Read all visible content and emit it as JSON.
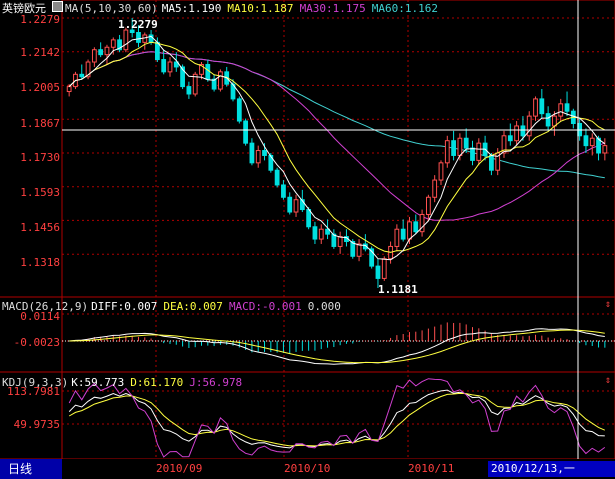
{
  "main_panel": {
    "title": "英镑欧元",
    "ma_label": "MA(5,10,30,60)",
    "ma5": "MA5:1.190",
    "ma10": "MA10:1.187",
    "ma30": "MA30:1.175",
    "ma60": "MA60:1.162",
    "high_marker": "1.2279",
    "low_marker": "1.1181",
    "y_ticks": [
      "1.2279",
      "1.2142",
      "1.2005",
      "1.1867",
      "1.1730",
      "1.1593",
      "1.1456",
      "1.1318"
    ]
  },
  "macd_panel": {
    "label": "MACD(26,12,9)",
    "diff": "DIFF:0.007",
    "dea": "DEA:0.007",
    "macd": "MACD:-0.001",
    "extra": "0.000",
    "y_ticks": [
      "0.0114",
      "-0.0023"
    ]
  },
  "kdj_panel": {
    "label": "KDJ(9,3,3)",
    "k": "K:59.773",
    "d": "D:61.170",
    "j": "J:56.978",
    "y_ticks": [
      "113.7981",
      "49.9735"
    ]
  },
  "footer": {
    "period_tab": "日线",
    "x_labels": [
      "2010/09",
      "2010/10",
      "2010/11"
    ],
    "cursor_date": "2010/12/13,一"
  },
  "colors": {
    "up": "#ff5050",
    "down": "#00e0e0",
    "ma5": "#ffffff",
    "ma10": "#ffff40",
    "ma30": "#d040d0",
    "ma60": "#40d0d0",
    "grid": "#b00000"
  },
  "chart_data": {
    "type": "candlestick",
    "price_range": [
      1.1181,
      1.2279
    ],
    "candles": [
      [
        1.198,
        1.201,
        1.196,
        1.2
      ],
      [
        1.2,
        1.206,
        1.199,
        1.205
      ],
      [
        1.205,
        1.209,
        1.203,
        1.204
      ],
      [
        1.204,
        1.211,
        1.203,
        1.21
      ],
      [
        1.21,
        1.216,
        1.208,
        1.215
      ],
      [
        1.215,
        1.218,
        1.212,
        1.213
      ],
      [
        1.213,
        1.217,
        1.209,
        1.216
      ],
      [
        1.216,
        1.22,
        1.213,
        1.219
      ],
      [
        1.219,
        1.221,
        1.214,
        1.215
      ],
      [
        1.215,
        1.224,
        1.214,
        1.223
      ],
      [
        1.223,
        1.2279,
        1.22,
        1.222
      ],
      [
        1.222,
        1.225,
        1.216,
        1.218
      ],
      [
        1.218,
        1.222,
        1.215,
        1.221
      ],
      [
        1.221,
        1.223,
        1.217,
        1.218
      ],
      [
        1.218,
        1.22,
        1.21,
        1.211
      ],
      [
        1.211,
        1.215,
        1.205,
        1.206
      ],
      [
        1.206,
        1.212,
        1.204,
        1.21
      ],
      [
        1.21,
        1.214,
        1.206,
        1.208
      ],
      [
        1.208,
        1.209,
        1.199,
        1.2
      ],
      [
        1.2,
        1.202,
        1.195,
        1.197
      ],
      [
        1.197,
        1.206,
        1.196,
        1.205
      ],
      [
        1.205,
        1.21,
        1.203,
        1.209
      ],
      [
        1.209,
        1.211,
        1.202,
        1.203
      ],
      [
        1.203,
        1.205,
        1.198,
        1.199
      ],
      [
        1.199,
        1.207,
        1.198,
        1.206
      ],
      [
        1.206,
        1.208,
        1.2,
        1.201
      ],
      [
        1.201,
        1.203,
        1.194,
        1.195
      ],
      [
        1.195,
        1.196,
        1.185,
        1.186
      ],
      [
        1.186,
        1.187,
        1.176,
        1.177
      ],
      [
        1.177,
        1.179,
        1.168,
        1.169
      ],
      [
        1.169,
        1.176,
        1.167,
        1.174
      ],
      [
        1.174,
        1.177,
        1.17,
        1.172
      ],
      [
        1.172,
        1.173,
        1.165,
        1.166
      ],
      [
        1.166,
        1.167,
        1.159,
        1.16
      ],
      [
        1.16,
        1.162,
        1.154,
        1.155
      ],
      [
        1.155,
        1.157,
        1.148,
        1.149
      ],
      [
        1.149,
        1.156,
        1.147,
        1.154
      ],
      [
        1.154,
        1.158,
        1.149,
        1.15
      ],
      [
        1.15,
        1.151,
        1.142,
        1.143
      ],
      [
        1.143,
        1.145,
        1.136,
        1.138
      ],
      [
        1.138,
        1.144,
        1.136,
        1.142
      ],
      [
        1.142,
        1.146,
        1.138,
        1.14
      ],
      [
        1.14,
        1.142,
        1.134,
        1.135
      ],
      [
        1.135,
        1.141,
        1.132,
        1.139
      ],
      [
        1.139,
        1.142,
        1.135,
        1.137
      ],
      [
        1.137,
        1.138,
        1.13,
        1.131
      ],
      [
        1.131,
        1.138,
        1.129,
        1.136
      ],
      [
        1.136,
        1.14,
        1.133,
        1.134
      ],
      [
        1.134,
        1.135,
        1.126,
        1.127
      ],
      [
        1.127,
        1.13,
        1.1181,
        1.122
      ],
      [
        1.122,
        1.131,
        1.121,
        1.13
      ],
      [
        1.13,
        1.137,
        1.128,
        1.135
      ],
      [
        1.135,
        1.144,
        1.133,
        1.142
      ],
      [
        1.142,
        1.146,
        1.137,
        1.138
      ],
      [
        1.138,
        1.147,
        1.136,
        1.145
      ],
      [
        1.145,
        1.148,
        1.14,
        1.141
      ],
      [
        1.141,
        1.15,
        1.139,
        1.148
      ],
      [
        1.148,
        1.156,
        1.146,
        1.155
      ],
      [
        1.155,
        1.164,
        1.153,
        1.162
      ],
      [
        1.162,
        1.17,
        1.16,
        1.169
      ],
      [
        1.169,
        1.18,
        1.167,
        1.178
      ],
      [
        1.178,
        1.182,
        1.17,
        1.172
      ],
      [
        1.172,
        1.181,
        1.17,
        1.179
      ],
      [
        1.179,
        1.183,
        1.173,
        1.175
      ],
      [
        1.175,
        1.178,
        1.168,
        1.17
      ],
      [
        1.17,
        1.179,
        1.168,
        1.177
      ],
      [
        1.177,
        1.18,
        1.17,
        1.172
      ],
      [
        1.172,
        1.173,
        1.164,
        1.166
      ],
      [
        1.166,
        1.175,
        1.164,
        1.173
      ],
      [
        1.173,
        1.182,
        1.171,
        1.18
      ],
      [
        1.18,
        1.185,
        1.176,
        1.178
      ],
      [
        1.178,
        1.186,
        1.176,
        1.184
      ],
      [
        1.184,
        1.188,
        1.178,
        1.18
      ],
      [
        1.18,
        1.19,
        1.178,
        1.188
      ],
      [
        1.188,
        1.196,
        1.186,
        1.195
      ],
      [
        1.195,
        1.199,
        1.187,
        1.189
      ],
      [
        1.189,
        1.192,
        1.182,
        1.184
      ],
      [
        1.184,
        1.19,
        1.18,
        1.188
      ],
      [
        1.188,
        1.195,
        1.186,
        1.193
      ],
      [
        1.193,
        1.198,
        1.188,
        1.19
      ],
      [
        1.19,
        1.191,
        1.183,
        1.185
      ],
      [
        1.185,
        1.187,
        1.178,
        1.18
      ],
      [
        1.18,
        1.183,
        1.173,
        1.176
      ],
      [
        1.176,
        1.181,
        1.172,
        1.179
      ],
      [
        1.179,
        1.18,
        1.17,
        1.173
      ],
      [
        1.173,
        1.179,
        1.17,
        1.176
      ]
    ]
  }
}
